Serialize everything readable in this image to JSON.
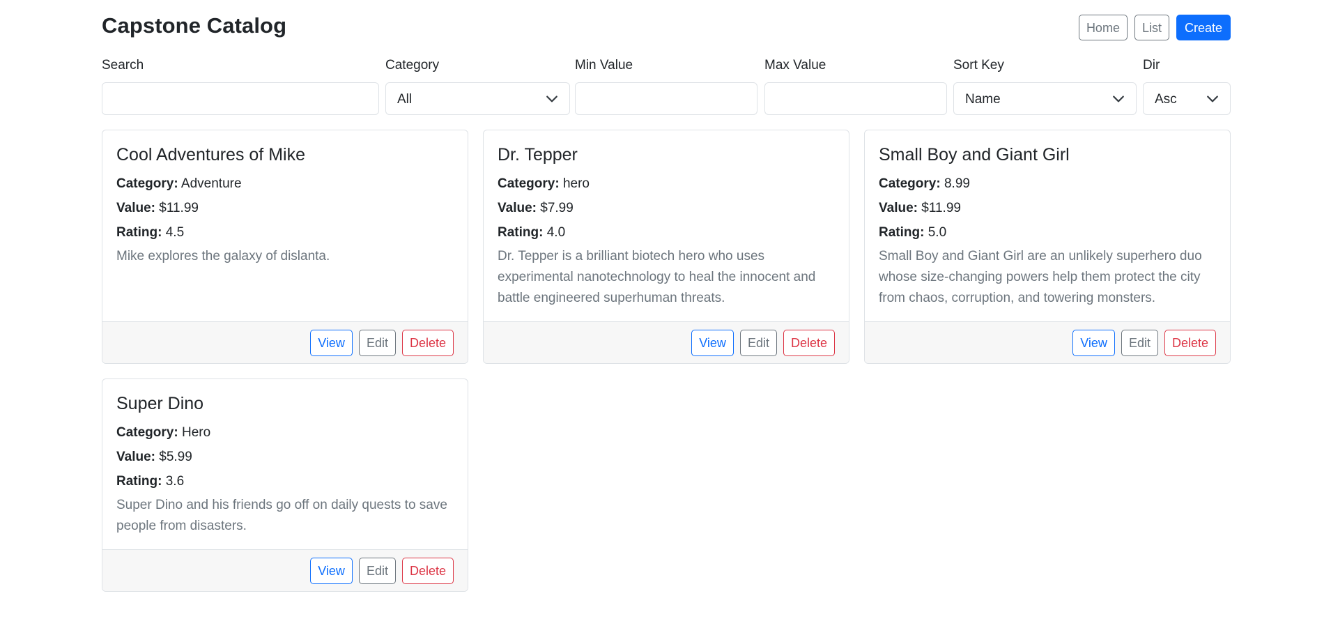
{
  "app": {
    "title": "Capstone Catalog",
    "nav": {
      "home": "Home",
      "list": "List",
      "create": "Create"
    }
  },
  "filters": {
    "search": {
      "label": "Search",
      "value": ""
    },
    "category": {
      "label": "Category",
      "selected": "All"
    },
    "min_value": {
      "label": "Min Value",
      "value": ""
    },
    "max_value": {
      "label": "Max Value",
      "value": ""
    },
    "sort_key": {
      "label": "Sort Key",
      "selected": "Name"
    },
    "dir": {
      "label": "Dir",
      "selected": "Asc"
    }
  },
  "field_labels": {
    "category": "Category:",
    "value": "Value:",
    "rating": "Rating:"
  },
  "actions": {
    "view": "View",
    "edit": "Edit",
    "delete": "Delete"
  },
  "items": [
    {
      "name": "Cool Adventures of Mike",
      "category": "Adventure",
      "value": "$11.99",
      "rating": "4.5",
      "description": "Mike explores the galaxy of dislanta."
    },
    {
      "name": "Dr. Tepper",
      "category": "hero",
      "value": "$7.99",
      "rating": "4.0",
      "description": "Dr. Tepper is a brilliant biotech hero who uses experimental nanotechnology to heal the innocent and battle engineered superhuman threats."
    },
    {
      "name": "Small Boy and Giant Girl",
      "category": "8.99",
      "value": "$11.99",
      "rating": "5.0",
      "description": "Small Boy and Giant Girl are an unlikely superhero duo whose size-changing powers help them protect the city from chaos, corruption, and towering monsters."
    },
    {
      "name": "Super Dino",
      "category": "Hero",
      "value": "$5.99",
      "rating": "3.6",
      "description": "Super Dino and his friends go off on daily quests to save people from disasters."
    }
  ]
}
